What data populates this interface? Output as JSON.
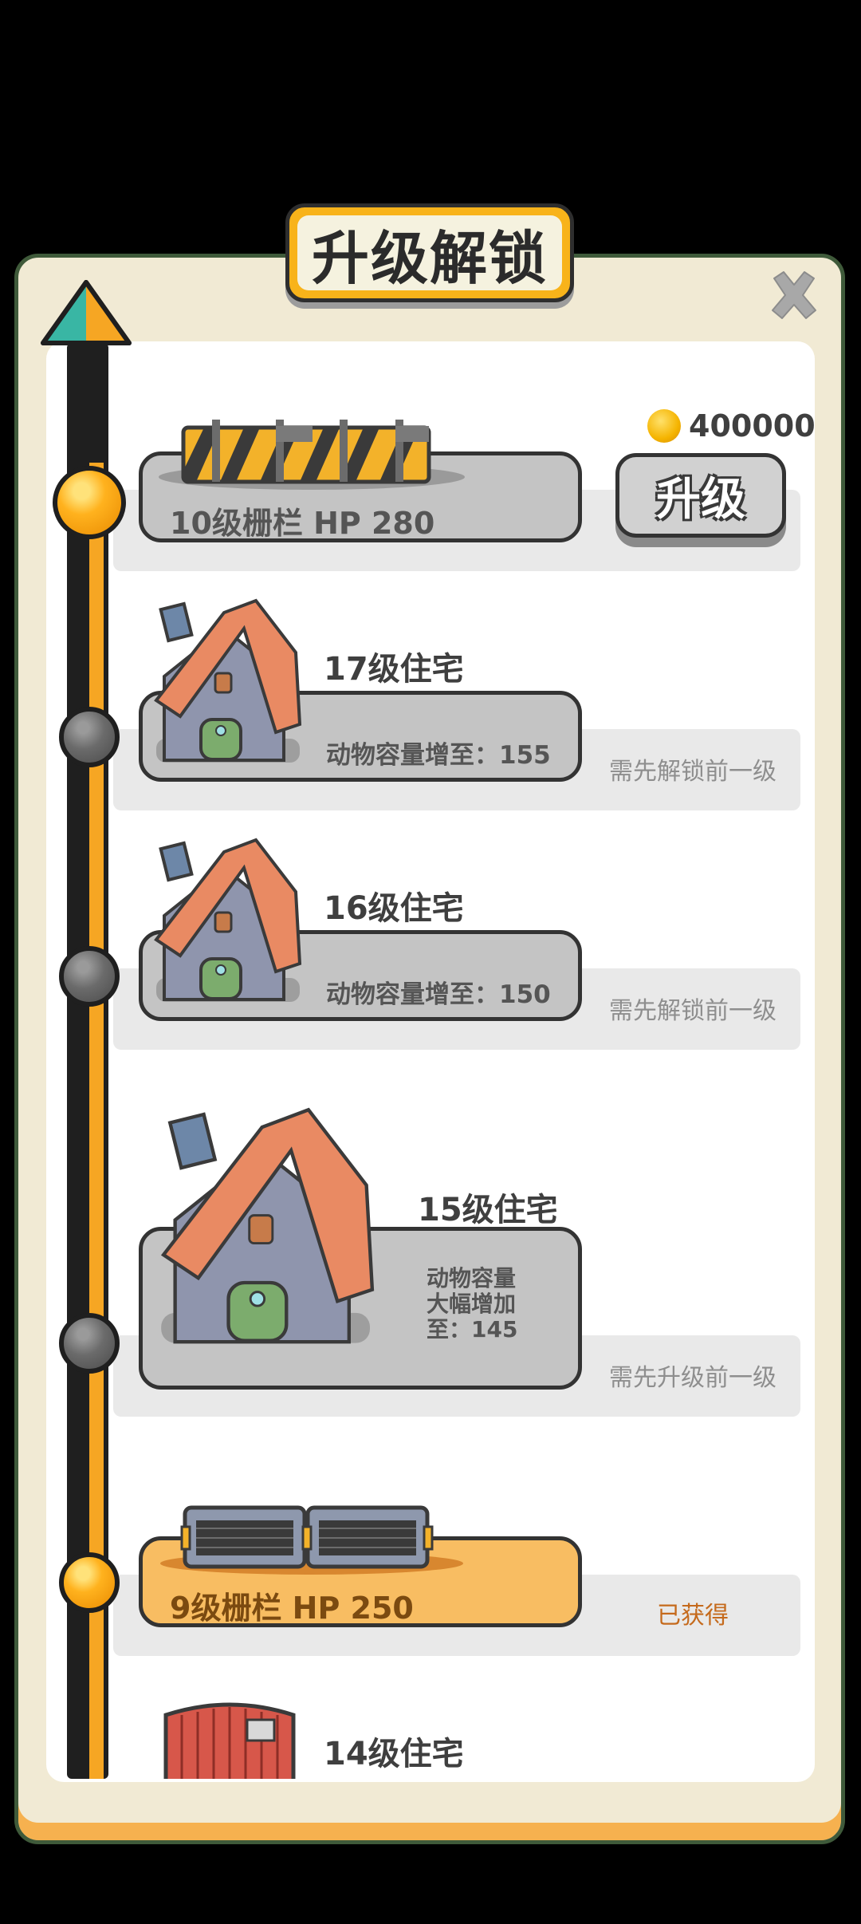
{
  "dialog": {
    "title": "升级解锁",
    "close_icon": "close-icon"
  },
  "colors": {
    "panel_bg": "#f1ead4",
    "title_gold": "#f8b31a",
    "timeline_orange": "#f6a623",
    "card_grey": "#c4c4c4",
    "card_gold": "#f8bd62",
    "obtained_text": "#c56a1c"
  },
  "items": [
    {
      "card_label": "10级栅栏 HP 280",
      "cost": "400000",
      "cost_icon": "gold-coin-icon",
      "action": "升级",
      "image": "striped-barrier-fence",
      "node": "gold"
    },
    {
      "title": "17级住宅",
      "card_label": "动物容量增至：155",
      "status": "需先解锁前一级",
      "image": "house",
      "node": "grey"
    },
    {
      "title": "16级住宅",
      "card_label": "动物容量增至：150",
      "status": "需先解锁前一级",
      "image": "house",
      "node": "grey"
    },
    {
      "title": "15级住宅",
      "card_label": "动物容量\n大幅增加\n至：145",
      "status": "需先升级前一级",
      "image": "house-large",
      "node": "grey"
    },
    {
      "card_label": "9级栅栏   HP 250",
      "status": "已获得",
      "image": "mesh-fence",
      "node": "gold"
    },
    {
      "title": "14级住宅",
      "image": "brick-house"
    }
  ]
}
